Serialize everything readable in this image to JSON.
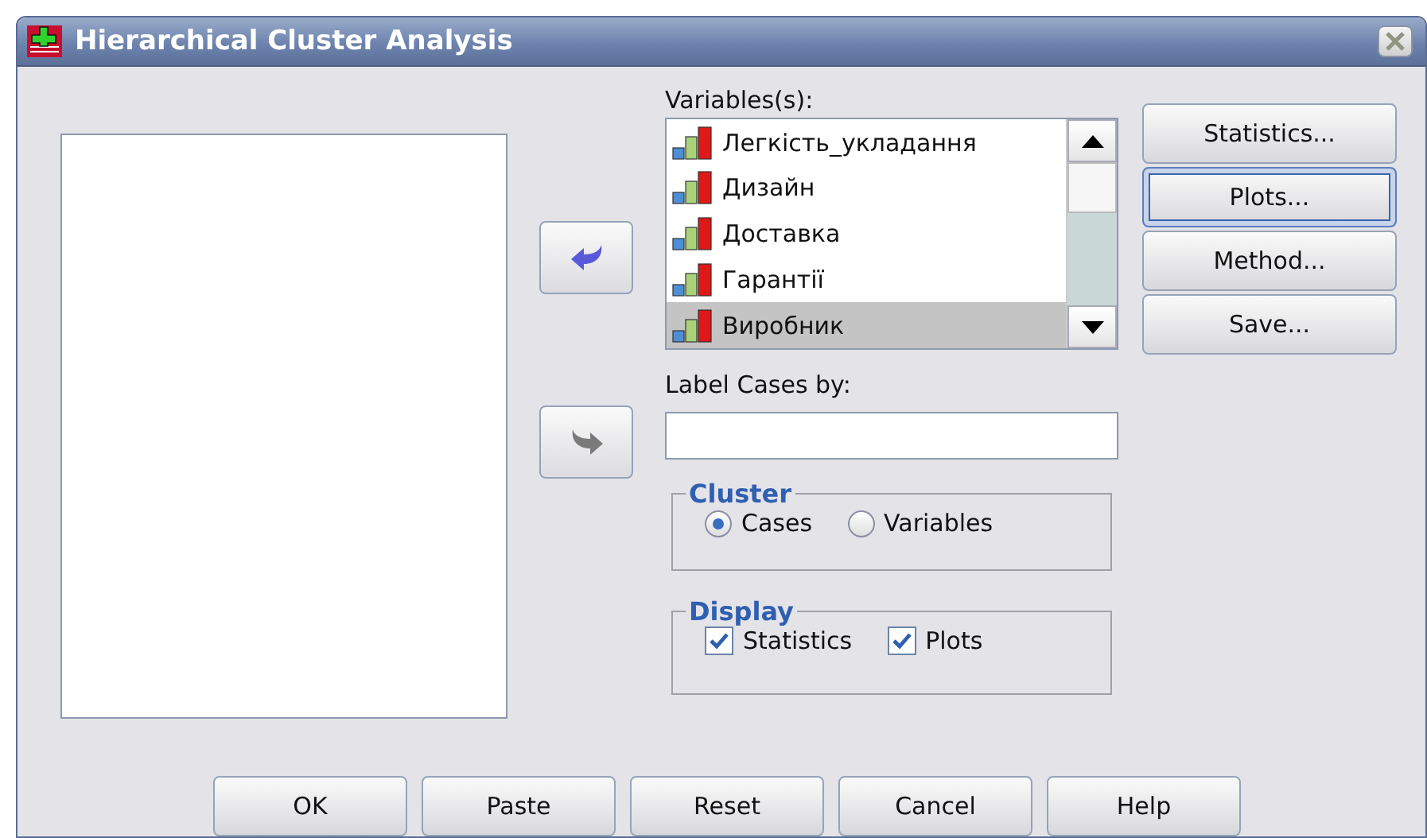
{
  "window": {
    "title": "Hierarchical Cluster Analysis"
  },
  "transfer_buttons": [
    {
      "kind": "left",
      "disabled": false
    },
    {
      "kind": "right",
      "disabled": true
    }
  ],
  "variables": {
    "label": "Variables(s):",
    "items": [
      {
        "name": "Легкість_укладання",
        "selected": false
      },
      {
        "name": "Дизайн",
        "selected": false
      },
      {
        "name": "Доставка",
        "selected": false
      },
      {
        "name": "Гарантії",
        "selected": false
      },
      {
        "name": "Виробник",
        "selected": true
      }
    ]
  },
  "side_buttons": [
    {
      "label": "Statistics...",
      "focused": false
    },
    {
      "label": "Plots...",
      "focused": true
    },
    {
      "label": "Method...",
      "focused": false
    },
    {
      "label": "Save...",
      "focused": false
    }
  ],
  "label_cases": {
    "label": "Label Cases by:"
  },
  "cluster": {
    "title": "Cluster",
    "options": [
      {
        "label": "Cases",
        "selected": true
      },
      {
        "label": "Variables",
        "selected": false
      }
    ]
  },
  "display": {
    "title": "Display",
    "options": [
      {
        "label": "Statistics",
        "checked": true
      },
      {
        "label": "Plots",
        "checked": true
      }
    ]
  },
  "buttons": [
    "OK",
    "Paste",
    "Reset",
    "Cancel",
    "Help"
  ]
}
